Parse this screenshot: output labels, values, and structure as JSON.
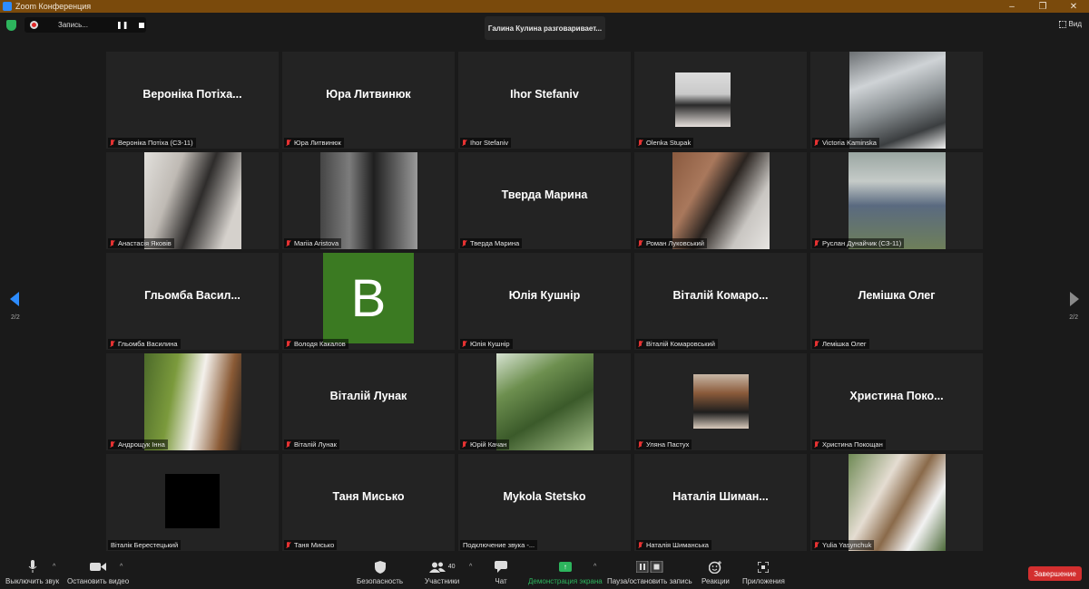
{
  "window": {
    "title": "Zoom Конференция",
    "minimize_glyph": "–",
    "maximize_glyph": "❐",
    "close_glyph": "✕"
  },
  "recording": {
    "label": "Запись...",
    "pause_glyph": "❚❚"
  },
  "speaking_banner": "Галина Кулина разговаривает...",
  "view_button": "Вид",
  "pages": {
    "left": "2/2",
    "right": "2/2"
  },
  "avatar_letter": "B",
  "participants": [
    {
      "big": "Вероніка Потіха...",
      "label": "Вероніка Потіха (СЗ-11)",
      "muted": true,
      "kind": "name"
    },
    {
      "big": "Юра Литвинюк",
      "label": "Юра Литвинюк",
      "muted": true,
      "kind": "name"
    },
    {
      "big": "Ihor Stefaniv",
      "label": "Ihor Stefaniv",
      "muted": true,
      "kind": "name"
    },
    {
      "big": "",
      "label": "Olenka Stupak",
      "muted": true,
      "kind": "photo"
    },
    {
      "big": "",
      "label": "Victoria Kaminska",
      "muted": true,
      "kind": "photo"
    },
    {
      "big": "",
      "label": "Анастасія Яковів",
      "muted": true,
      "kind": "photo"
    },
    {
      "big": "",
      "label": "Mariia Aristova",
      "muted": true,
      "kind": "photo"
    },
    {
      "big": "Тверда Марина",
      "label": "Тверда Марина",
      "muted": true,
      "kind": "name"
    },
    {
      "big": "",
      "label": "Роман Луковський",
      "muted": true,
      "kind": "photo"
    },
    {
      "big": "",
      "label": "Руслан Дунайчик (СЗ-11)",
      "muted": true,
      "kind": "photo"
    },
    {
      "big": "Гльомба Васил...",
      "label": "Гльомба Василина",
      "muted": true,
      "kind": "name"
    },
    {
      "big": "",
      "label": "Володя Какалов",
      "muted": true,
      "kind": "avatar"
    },
    {
      "big": "Юлія Кушнір",
      "label": "Юлія Кушнір",
      "muted": true,
      "kind": "name"
    },
    {
      "big": "Віталій Комаро...",
      "label": "Віталій Комаровський",
      "muted": true,
      "kind": "name"
    },
    {
      "big": "Лемішка Олег",
      "label": "Лемішка Олег",
      "muted": true,
      "kind": "name"
    },
    {
      "big": "",
      "label": "Андрощук Інна",
      "muted": true,
      "kind": "photo"
    },
    {
      "big": "Віталій Лунак",
      "label": "Віталій Лунак",
      "muted": true,
      "kind": "name"
    },
    {
      "big": "",
      "label": "Юрій Качан",
      "muted": true,
      "kind": "photo"
    },
    {
      "big": "",
      "label": "Уляна Пастух",
      "muted": true,
      "kind": "photo"
    },
    {
      "big": "Христина Поко...",
      "label": "Христина Покощан",
      "muted": true,
      "kind": "name"
    },
    {
      "big": "",
      "label": "Віталік Берестецький",
      "muted": false,
      "kind": "blank"
    },
    {
      "big": "Таня Мисько",
      "label": "Таня Мисько",
      "muted": true,
      "kind": "name"
    },
    {
      "big": "Mykola Stetsko",
      "label": "Подключение звука -...",
      "muted": false,
      "kind": "name"
    },
    {
      "big": "Наталія Шиман...",
      "label": "Наталія Шиманська",
      "muted": true,
      "kind": "name"
    },
    {
      "big": "",
      "label": "Yulia Yasynchuk",
      "muted": true,
      "kind": "photo"
    }
  ],
  "toolbar": {
    "mute": "Выключить звук",
    "stop_video": "Остановить видео",
    "security": "Безопасность",
    "participants": "Участники",
    "participants_count": "40",
    "chat": "Чат",
    "share": "Демонстрация экрана",
    "record": "Пауза/остановить запись",
    "reactions": "Реакции",
    "apps": "Приложения",
    "end": "Завершение"
  },
  "colors": {
    "accent": "#2d8cff",
    "share_green": "#2db55d",
    "end_red": "#d32f2f",
    "titlebar": "#7a4a0c"
  }
}
